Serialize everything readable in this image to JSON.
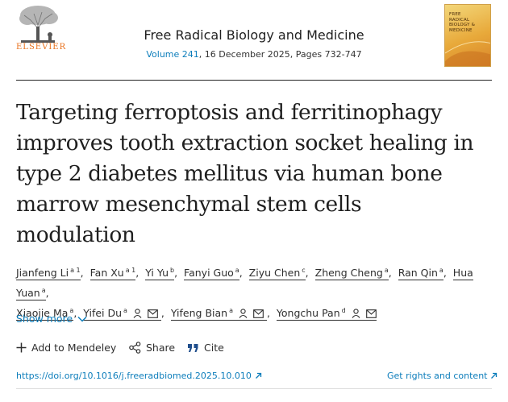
{
  "header": {
    "publisher": "ELSEVIER",
    "journal_title": "Free Radical Biology and Medicine",
    "volume_link": "Volume 241",
    "issue_details": ", 16 December 2025, Pages 732-747",
    "cover_text": "FREE\nRADICAL\nBIOLOGY &\nMEDICINE"
  },
  "article": {
    "title_lines": [
      "Targeting ferroptosis and ferritinophagy",
      "improves tooth extraction socket healing in",
      "type 2 diabetes mellitus via human bone",
      "marrow mesenchymal stem cells",
      "modulation"
    ]
  },
  "authors": [
    {
      "name": "Jianfeng Li",
      "sup": "a 1"
    },
    {
      "name": "Fan Xu",
      "sup": "a 1"
    },
    {
      "name": "Yi Yu",
      "sup": "b"
    },
    {
      "name": "Fanyi Guo",
      "sup": "a"
    },
    {
      "name": "Ziyu Chen",
      "sup": "c"
    },
    {
      "name": "Zheng Cheng",
      "sup": "a"
    },
    {
      "name": "Ran Qin",
      "sup": "a"
    },
    {
      "name": "Hua Yuan",
      "sup": "a"
    },
    {
      "name": "Xiaojie Ma",
      "sup": "a"
    },
    {
      "name": "Yifei Du",
      "sup": "a"
    },
    {
      "name": "Yifeng Bian",
      "sup": "a"
    },
    {
      "name": "Yongchu Pan",
      "sup": "d"
    }
  ],
  "show_more": "Show more",
  "actions": {
    "mendeley": "Add to Mendeley",
    "share": "Share",
    "cite": "Cite"
  },
  "links": {
    "doi": "https://doi.org/10.1016/j.freeradbiomed.2025.10.010",
    "rights": "Get rights and content"
  },
  "colors": {
    "link": "#0c7dbb",
    "elsevier_orange": "#e9711c",
    "text": "#2e2e2e"
  }
}
